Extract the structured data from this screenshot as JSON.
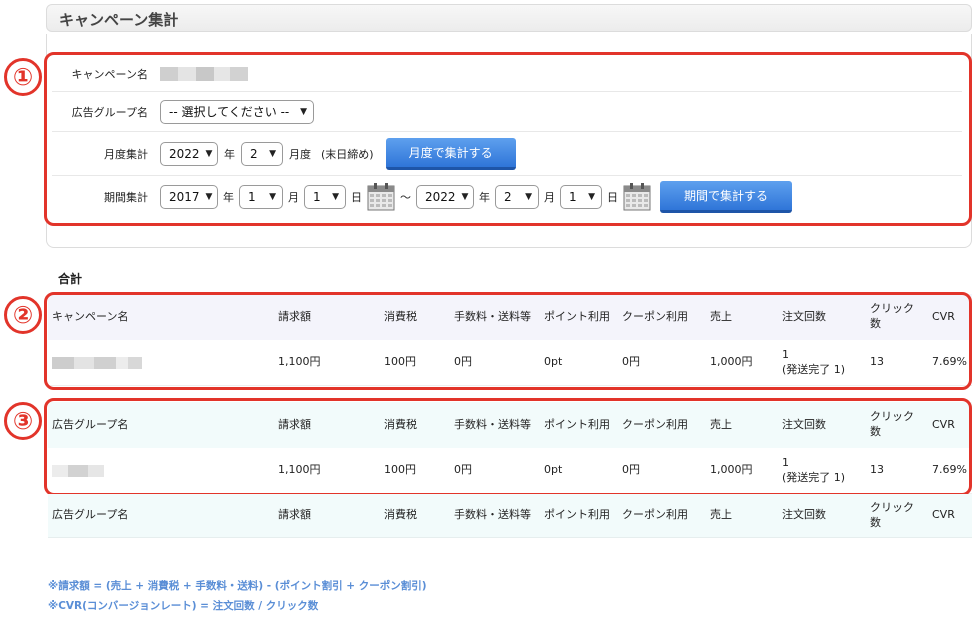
{
  "page": {
    "title": "キャンペーン集計"
  },
  "badges": [
    "①",
    "②",
    "③"
  ],
  "form": {
    "campaign_label": "キャンペーン名",
    "adgroup_label": "広告グループ名",
    "adgroup_select": "-- 選択してください --",
    "monthly": {
      "label": "月度集計",
      "year": "2022",
      "year_unit": "年",
      "month": "2",
      "month_unit": "月度",
      "note": "(末日締め)",
      "button": "月度で集計する"
    },
    "period": {
      "label": "期間集計",
      "from_year": "2017",
      "year_unit": "年",
      "from_month": "1",
      "month_unit": "月",
      "from_day": "1",
      "day_unit": "日",
      "tilde": "～",
      "to_year": "2022",
      "to_month": "2",
      "to_day": "1",
      "button": "期間で集計する"
    }
  },
  "summary": {
    "heading": "合計"
  },
  "table_columns": [
    "請求額",
    "消費税",
    "手数料・送料等",
    "ポイント利用",
    "クーポン利用",
    "売上",
    "注文回数",
    "クリック\n数",
    "CVR"
  ],
  "campaign_table": {
    "first_header": "キャンペーン名",
    "row": [
      "1,100円",
      "100円",
      "0円",
      "0pt",
      "0円",
      "1,000円",
      "1\n(発送完了 1)",
      "13",
      "7.69%"
    ]
  },
  "adgroup_table": {
    "first_header": "広告グループ名",
    "row": [
      "1,100円",
      "100円",
      "0円",
      "0pt",
      "0円",
      "1,000円",
      "1\n(発送完了 1)",
      "13",
      "7.69%"
    ]
  },
  "adgroup_table_2": {
    "first_header": "広告グループ名"
  },
  "colors": {
    "accent": "#e2342a",
    "button": "#2f75d8",
    "footnote": "#5a8ed6",
    "header_campaign": "#f4f4fb",
    "header_adgroup": "#f2fbfb"
  },
  "footnotes": {
    "line1": "※請求額 = (売上 + 消費税 + 手数料・送料) - (ポイント割引 + クーポン割引)",
    "line2": "※CVR(コンバージョンレート) = 注文回数 / クリック数"
  }
}
